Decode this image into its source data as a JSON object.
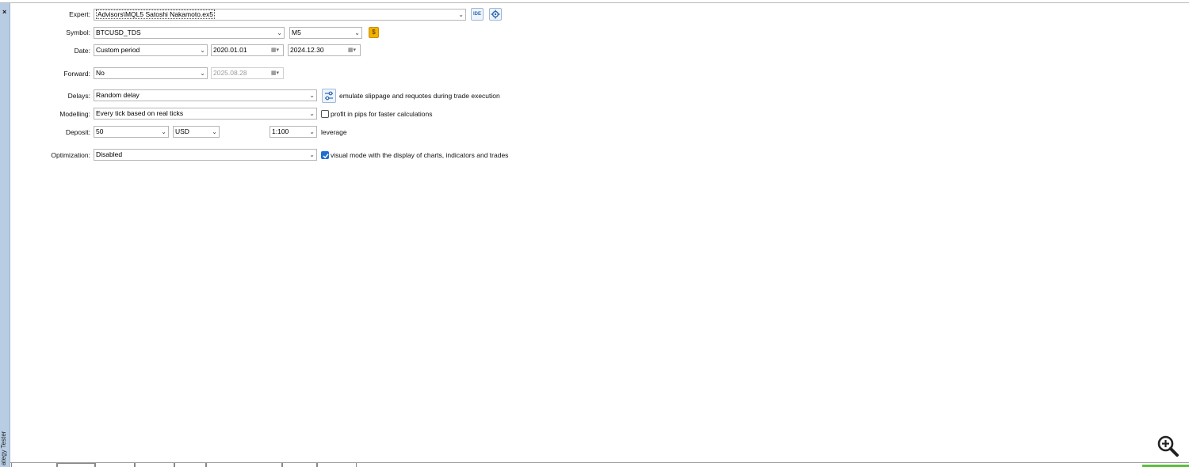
{
  "panel": {
    "close_glyph": "×",
    "vertical_title": "ategy Tester"
  },
  "form": {
    "expert": {
      "label": "Expert:",
      "value": "Advisors\\MQL5 Satoshi Nakamoto.ex5",
      "ide_label": "IDE"
    },
    "symbol": {
      "label": "Symbol:",
      "value": "BTCUSD_TDS",
      "timeframe": "M5",
      "symbol_spec_glyph": "$"
    },
    "date": {
      "label": "Date:",
      "period": "Custom period",
      "from": "2020.01.01",
      "to": "2024.12.30"
    },
    "forward": {
      "label": "Forward:",
      "value": "No",
      "date": "2025.08.28"
    },
    "delays": {
      "label": "Delays:",
      "value": "Random delay",
      "note": "emulate slippage and requotes during trade execution"
    },
    "modelling": {
      "label": "Modelling:",
      "value": "Every tick based on real ticks",
      "pips_checkbox_label": "profit in pips for faster calculations",
      "pips_checked": false
    },
    "deposit": {
      "label": "Deposit:",
      "amount": "50",
      "currency": "USD",
      "leverage_value": "1:100",
      "leverage_label": "leverage"
    },
    "optimization": {
      "label": "Optimization:",
      "value": "Disabled",
      "visual_checkbox_label": "visual mode with the display of charts, indicators and trades",
      "visual_checked": true
    }
  },
  "icons": {
    "dropdown": "chevron-down-icon",
    "calendar": "calendar-icon",
    "settings": "gear-icon",
    "delay_settings": "sliders-icon",
    "zoom": "zoom-in-icon"
  },
  "colors": {
    "accent_blue": "#1f6fd0",
    "panel_strip": "#b8cde4",
    "symbol_button": "#f2b200",
    "status_green": "#5bbf3e"
  }
}
